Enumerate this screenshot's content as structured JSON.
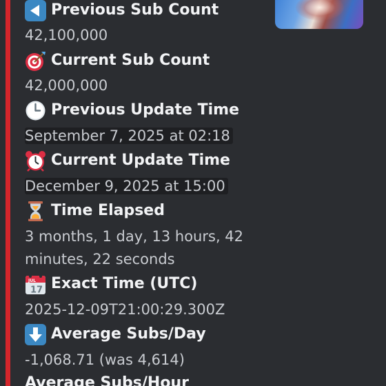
{
  "fields": [
    {
      "name": "Previous Sub Count",
      "value": "42,100,000",
      "icon": "left-arrow-icon"
    },
    {
      "name": "Current Sub Count",
      "value": "42,000,000",
      "icon": "dart-target-icon"
    },
    {
      "name": "Previous Update Time",
      "value": "September 7, 2025 at 02:18",
      "icon": "clock-icon"
    },
    {
      "name": "Current Update Time",
      "value": "December 9, 2025 at 15:00",
      "icon": "alarm-clock-icon"
    },
    {
      "name": "Time Elapsed",
      "value": "3 months, 1 day, 13 hours, 42 minutes, 22 seconds",
      "icon": "hourglass-icon"
    },
    {
      "name": "Exact Time (UTC)",
      "value": "2025-12-09T21:00:29.300Z",
      "icon": "calendar-icon"
    },
    {
      "name": "Average Subs/Day",
      "value": "-1,068.71 (was 4,614)",
      "icon": "down-arrow-icon"
    },
    {
      "name": "Average Subs/Hour",
      "value": "",
      "icon": ""
    }
  ],
  "calendar_icon_text": {
    "month": "JUL",
    "day": "17"
  },
  "colors": {
    "accent": "#d4252b",
    "background": "#2b2d31",
    "field_name": "#f2f3f5",
    "field_value": "#c9ccd1",
    "icon_blue": "#3b88c3"
  }
}
